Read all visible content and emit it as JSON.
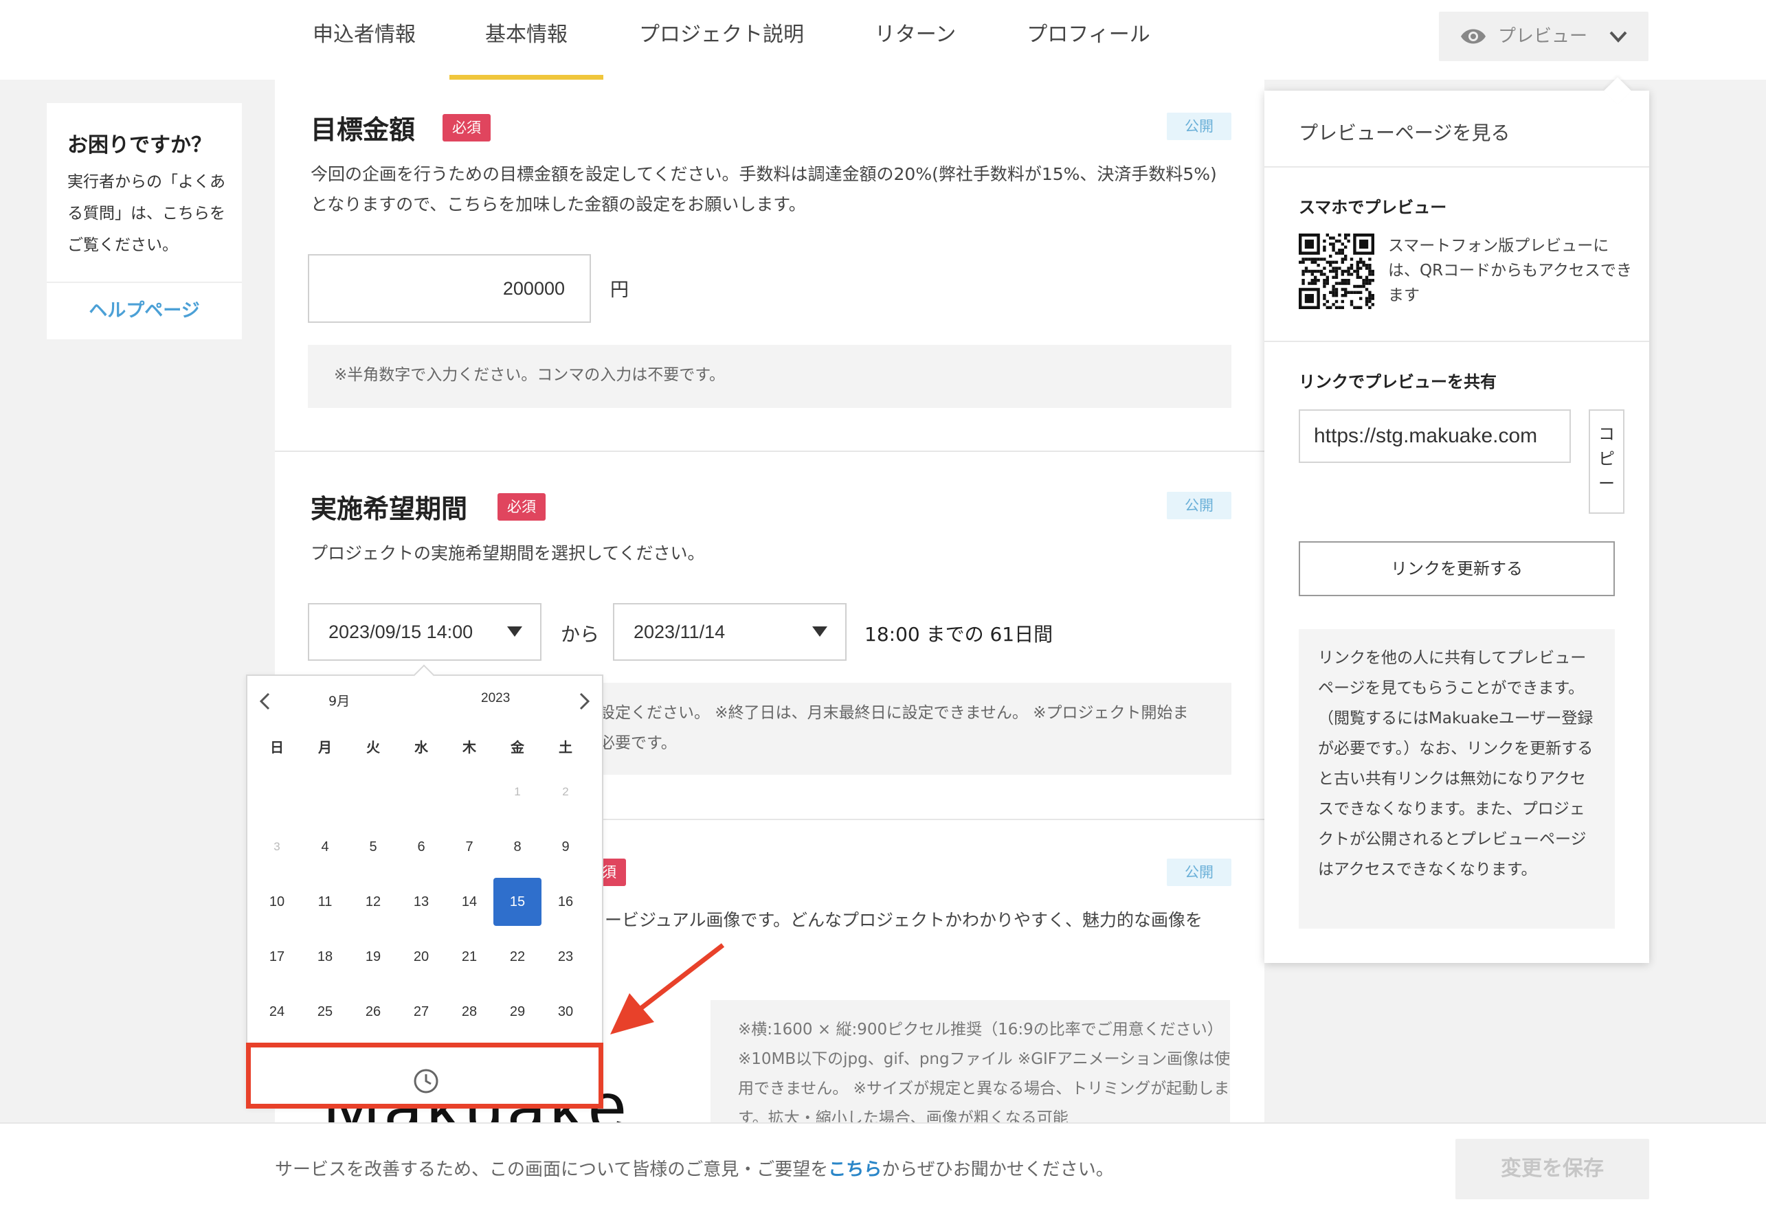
{
  "nav": {
    "tabs": [
      {
        "label": "申込者情報"
      },
      {
        "label": "基本情報",
        "active": true
      },
      {
        "label": "プロジェクト説明"
      },
      {
        "label": "リターン"
      },
      {
        "label": "プロフィール"
      }
    ],
    "preview_label": "プレビュー"
  },
  "help": {
    "title": "お困りですか？",
    "body": "実行者からの「よくある質問」は、こちらをご覧ください。",
    "link": "ヘルプページ"
  },
  "goal": {
    "title": "目標金額",
    "required": "必須",
    "visibility": "公開",
    "description": "今回の企画を行うための目標金額を設定してください。手数料は調達金額の20%(弊社手数料が15%、決済手数料5%)となりますので、こちらを加味した金額の設定をお願いします。",
    "value": "200000",
    "unit": "円",
    "note": "※半角数字で入力ください。コンマの入力は不要です。"
  },
  "period": {
    "title": "実施希望期間",
    "required": "必須",
    "visibility": "公開",
    "description": "プロジェクトの実施希望期間を選択してください。",
    "start": "2023/09/15 14:00",
    "from_label": "から",
    "end": "2023/11/14",
    "duration": "18:00 までの 61日間",
    "note_fragment_1": "設定ください。 ※終了日は、月末最終日に設定できません。 ※プロジェクト開始ま",
    "note_fragment_2": "必要です。"
  },
  "image": {
    "required": "須",
    "visibility": "公開",
    "description_fragment": "ービジュアル画像です。どんなプロジェクトかわかりやすく、魅力的な画像を",
    "note": "※横:1600 × 縦:900ピクセル推奨（16:9の比率でご用意ください） ※10MB以下のjpg、gif、pngファイル ※GIFアニメーション画像は使用できません。 ※サイズが規定と異なる場合、トリミングが起動します。拡大・縮小した場合、画像が粗くなる可能",
    "logo_text": "Makuake"
  },
  "datepicker": {
    "month": "9月",
    "year": "2023",
    "weekdays": [
      "日",
      "月",
      "火",
      "水",
      "木",
      "金",
      "土"
    ],
    "weeks": [
      [
        "",
        "",
        "",
        "",
        "",
        "1",
        "2"
      ],
      [
        "3",
        "4",
        "5",
        "6",
        "7",
        "8",
        "9"
      ],
      [
        "10",
        "11",
        "12",
        "13",
        "14",
        "15",
        "16"
      ],
      [
        "17",
        "18",
        "19",
        "20",
        "21",
        "22",
        "23"
      ],
      [
        "24",
        "25",
        "26",
        "27",
        "28",
        "29",
        "30"
      ]
    ],
    "selected": "15",
    "dimmed": [
      "1",
      "2",
      "3"
    ]
  },
  "preview": {
    "heading": "プレビューページを見る",
    "mobile_title": "スマホでプレビュー",
    "mobile_text": "スマートフォン版プレビューには、QRコードからもアクセスできます",
    "share_title": "リンクでプレビューを共有",
    "url": "https://stg.makuake.com",
    "copy": "コピー",
    "refresh": "リンクを更新する",
    "info": "リンクを他の人に共有してプレビューページを見てもらうことができます。（閲覧するにはMakuakeユーザー登録が必要です。）なお、リンクを更新すると古い共有リンクは無効になりアクセスできなくなります。また、プロジェクトが公開されるとプレビューページはアクセスできなくなります。"
  },
  "footer": {
    "text_before": "サービスを改善するため、この画面について皆様のご意見・ご要望を",
    "link": "こちら",
    "text_after": "からぜひお聞かせください。",
    "save": "変更を保存"
  },
  "colors": {
    "accent_tab": "#f0c63c",
    "required_badge": "#e0455e",
    "selected_day": "#2f6fcc",
    "annotation": "#e8412a",
    "link": "#4ba0d6"
  }
}
